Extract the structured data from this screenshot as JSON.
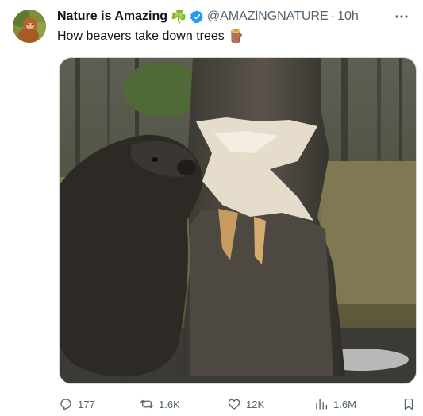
{
  "tweet": {
    "author_name": "Nature is Amazing",
    "author_emoji": "☘️",
    "handle": "@AMAZlNGNATURE",
    "separator": "·",
    "time": "10h",
    "text": "How beavers take down trees",
    "text_emoji": "🪵"
  },
  "actions": {
    "replies": "177",
    "reposts": "1.6K",
    "likes": "12K",
    "views": "1.6M"
  },
  "colors": {
    "verified": "#1d9bf0",
    "muted": "#536471"
  }
}
